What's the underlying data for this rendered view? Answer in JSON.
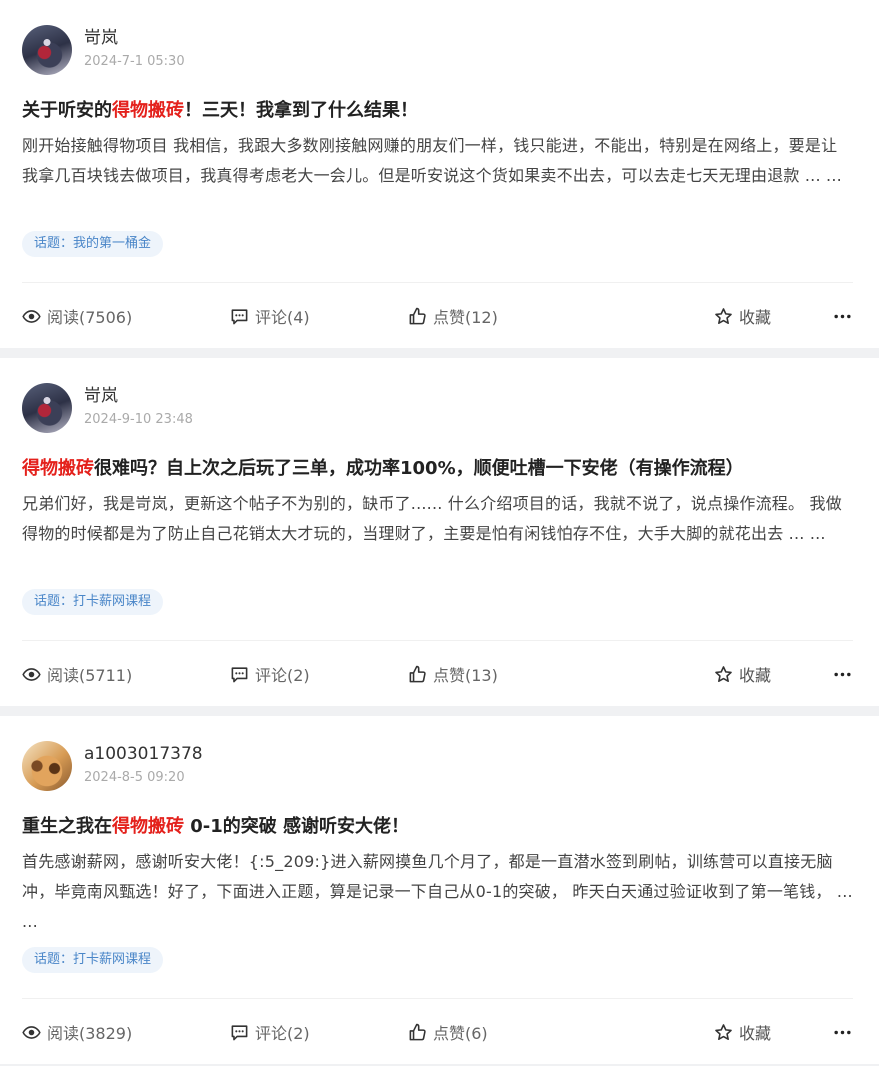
{
  "posts": [
    {
      "author": "岢岚",
      "datetime": "2024-7-1 05:30",
      "avatar_icon": "avatar-landscape-icon",
      "title_before": "关于听安的",
      "title_highlight": "得物搬砖",
      "title_after": "！三天！我拿到了什么结果！",
      "excerpt": "刚开始接触得物项目 我相信，我跟大多数刚接触网赚的朋友们一样，钱只能进，不能出，特别是在网络上，要是让我拿几百块钱去做项目，我真得考虑老大一会儿。但是听安说这个货如果卖不出去，可以去走七天无理由退款 ... ...",
      "topic": "话题：我的第一桶金",
      "reads": "阅读(7506)",
      "comments": "评论(4)",
      "likes": "点赞(12)",
      "favorite": "收藏"
    },
    {
      "author": "岢岚",
      "datetime": "2024-9-10 23:48",
      "avatar_icon": "avatar-landscape-icon",
      "title_before": "",
      "title_highlight": "得物搬砖",
      "title_after": "很难吗？自上次之后玩了三单，成功率100%，顺便吐槽一下安佬（有操作流程）",
      "excerpt": "兄弟们好，我是岢岚，更新这个帖子不为别的，缺币了...... 什么介绍项目的话，我就不说了，说点操作流程。 我做得物的时候都是为了防止自己花销太大才玩的，当理财了，主要是怕有闲钱怕存不住，大手大脚的就花出去 ... ...",
      "topic": "话题：打卡薪网课程",
      "reads": "阅读(5711)",
      "comments": "评论(2)",
      "likes": "点赞(13)",
      "favorite": "收藏"
    },
    {
      "author": "a1003017378",
      "datetime": "2024-8-5 09:20",
      "avatar_icon": "avatar-cat-icon",
      "title_before": "重生之我在",
      "title_highlight": "得物搬砖",
      "title_after": " 0-1的突破 感谢听安大佬！",
      "excerpt": "首先感谢薪网，感谢听安大佬！{:5_209:}进入薪网摸鱼几个月了，都是一直潜水签到刷帖，训练营可以直接无脑冲，毕竟南风甄选！好了，下面进入正题，算是记录一下自己从0-1的突破， 昨天白天通过验证收到了第一笔钱， ... ...",
      "topic": "话题：打卡薪网课程",
      "reads": "阅读(3829)",
      "comments": "评论(2)",
      "likes": "点赞(6)",
      "favorite": "收藏"
    }
  ],
  "colors": {
    "highlight": "#e4211c",
    "topic_text": "#4a86c8",
    "topic_bg": "#eef4fb"
  }
}
